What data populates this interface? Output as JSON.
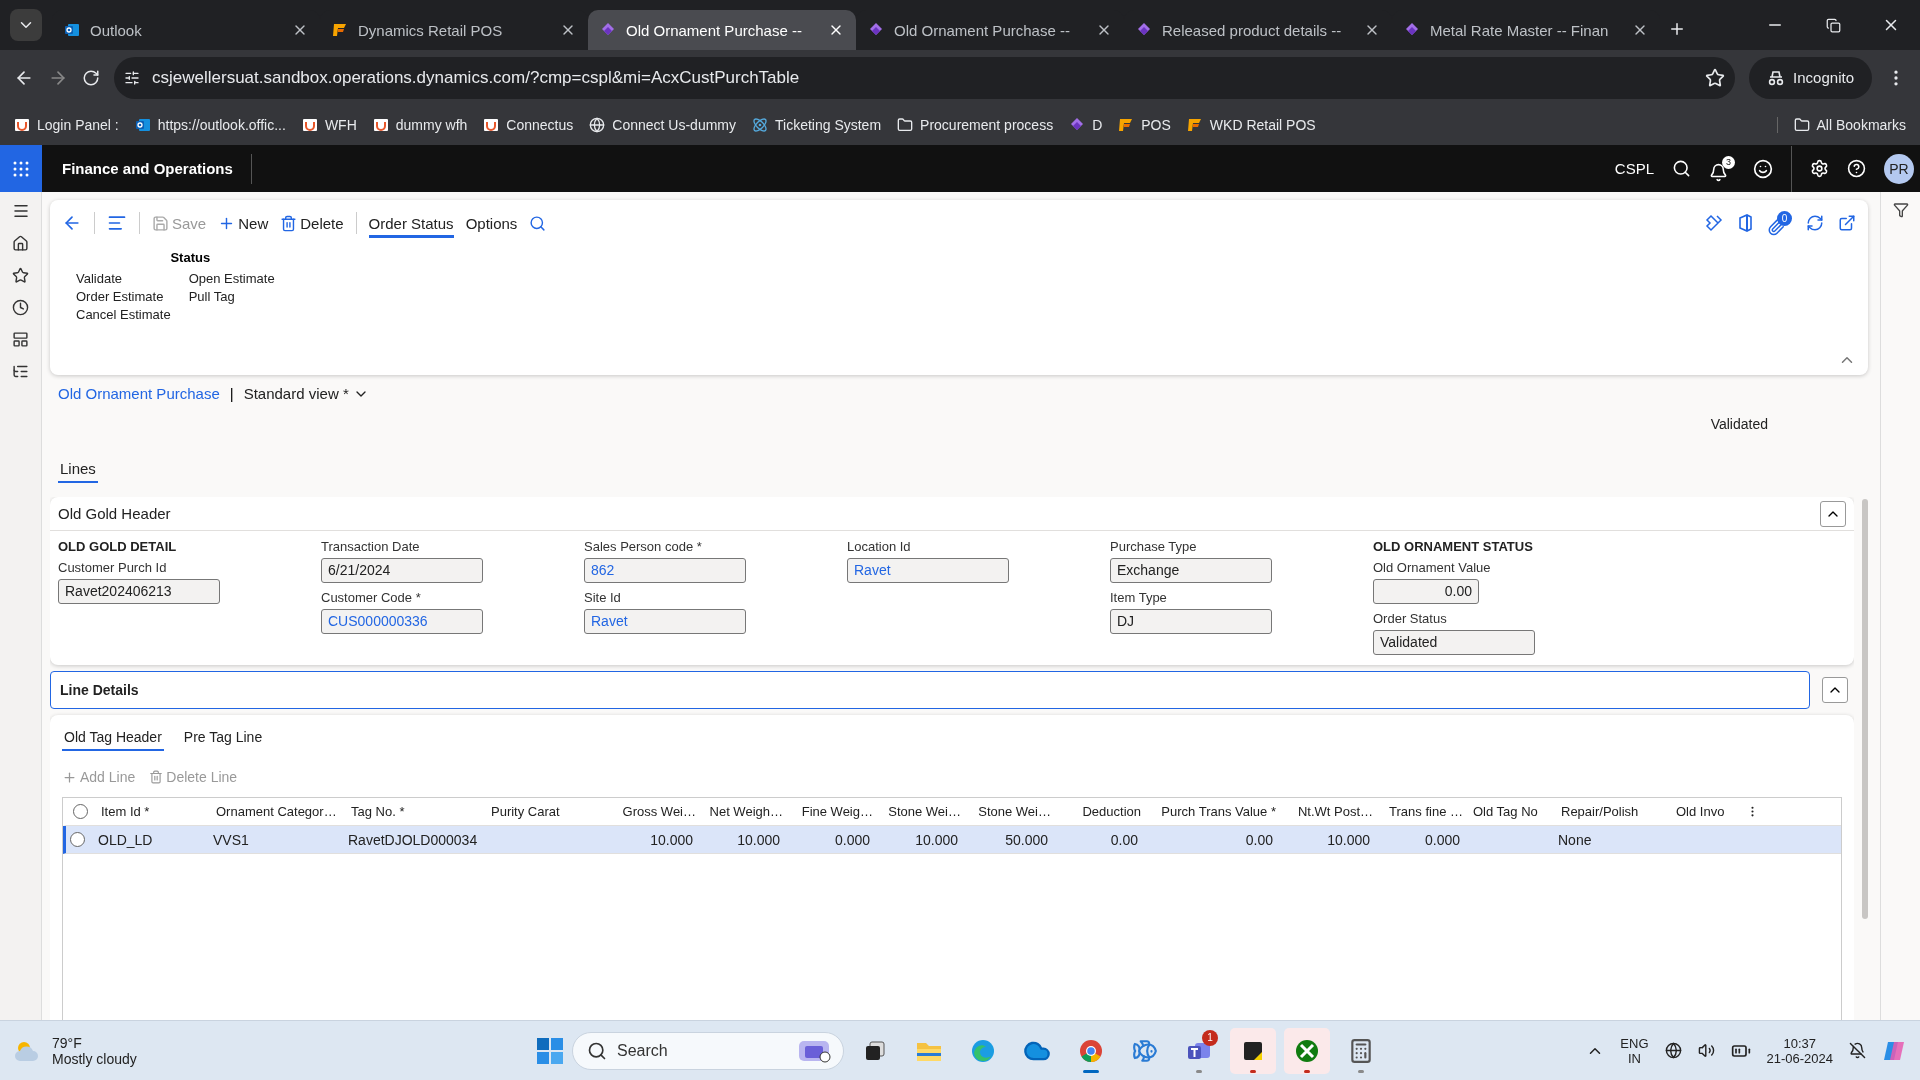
{
  "browser": {
    "tabs": [
      {
        "title": "Outlook",
        "selected": false
      },
      {
        "title": "Dynamics Retail POS",
        "selected": false
      },
      {
        "title": "Old Ornament Purchase --",
        "selected": true
      },
      {
        "title": "Old Ornament Purchase --",
        "selected": false
      },
      {
        "title": "Released product details --",
        "selected": false
      },
      {
        "title": "Metal Rate Master -- Finan",
        "selected": false
      }
    ],
    "address": "csjewellersuat.sandbox.operations.dynamics.com/?cmp=cspl&mi=AcxCustPurchTable",
    "profile": "Incognito",
    "bookmarks": [
      "Login Panel :",
      "https://outlook.offic...",
      "WFH",
      "dummy wfh",
      "Connectus",
      "Connect Us-dummy",
      "Ticketing System",
      "Procurement process",
      "D",
      "POS",
      "WKD Retail POS"
    ],
    "all_bookmarks": "All Bookmarks"
  },
  "app": {
    "title": "Finance and Operations",
    "company": "CSPL",
    "notifications": "3",
    "avatar": "PR"
  },
  "action_pane": {
    "buttons": [
      {
        "label": "Save",
        "kind": "save",
        "disabled": true
      },
      {
        "label": "New",
        "kind": "new",
        "disabled": false
      },
      {
        "label": "Delete",
        "kind": "delete",
        "disabled": false
      }
    ],
    "tabs": [
      {
        "label": "Order Status",
        "selected": true
      },
      {
        "label": "Options",
        "selected": false
      }
    ],
    "attachments": "0",
    "group": {
      "title": "Status",
      "columns": [
        [
          "Validate",
          "Order Estimate",
          "Cancel Estimate"
        ],
        [
          "Open Estimate",
          "Pull Tag"
        ]
      ]
    }
  },
  "breadcrumb": {
    "form": "Old Ornament Purchase",
    "separator": "|",
    "view": "Standard view *"
  },
  "record_status": "Validated",
  "page_tabs": [
    {
      "label": "Lines",
      "selected": true
    }
  ],
  "header": {
    "title": "Old Gold Header",
    "columns": [
      [
        {
          "kind": "heading",
          "label": "OLD GOLD DETAIL"
        },
        {
          "kind": "field",
          "label": "Customer Purch Id",
          "value": "Ravet202406213",
          "link": false,
          "numeric": false
        }
      ],
      [
        {
          "kind": "field",
          "label": "Transaction Date",
          "value": "6/21/2024",
          "link": false,
          "numeric": false
        },
        {
          "kind": "field",
          "label": "Customer Code *",
          "value": "CUS000000336",
          "link": true,
          "numeric": false
        }
      ],
      [
        {
          "kind": "field",
          "label": "Sales Person code *",
          "value": "862",
          "link": true,
          "numeric": false
        },
        {
          "kind": "field",
          "label": "Site Id",
          "value": "Ravet",
          "link": true,
          "numeric": false
        }
      ],
      [
        {
          "kind": "field",
          "label": "Location Id",
          "value": "Ravet",
          "link": true,
          "numeric": false
        }
      ],
      [
        {
          "kind": "field",
          "label": "Purchase Type",
          "value": "Exchange",
          "link": false,
          "numeric": false
        },
        {
          "kind": "field",
          "label": "Item Type",
          "value": "DJ",
          "link": false,
          "numeric": false
        }
      ],
      [
        {
          "kind": "heading",
          "label": "OLD ORNAMENT STATUS"
        },
        {
          "kind": "field",
          "label": "Old Ornament Value",
          "value": "0.00",
          "link": false,
          "numeric": true
        },
        {
          "kind": "field",
          "label": "Order Status",
          "value": "Validated",
          "link": false,
          "numeric": false
        }
      ]
    ]
  },
  "line_details": {
    "title": "Line Details",
    "tabs": [
      {
        "label": "Old Tag Header",
        "selected": true
      },
      {
        "label": "Pre Tag Line",
        "selected": false
      }
    ],
    "toolbar": [
      {
        "label": "Add Line",
        "kind": "add",
        "disabled": true
      },
      {
        "label": "Delete Line",
        "kind": "delete",
        "disabled": true
      }
    ],
    "all_selected": false,
    "columns": [
      {
        "label": "Item Id *",
        "numeric": false
      },
      {
        "label": "Ornament Categor…",
        "numeric": false
      },
      {
        "label": "Tag No. *",
        "numeric": false
      },
      {
        "label": "Purity Carat",
        "numeric": false
      },
      {
        "label": "Gross Wei…",
        "numeric": true
      },
      {
        "label": "Net Weigh…",
        "numeric": true
      },
      {
        "label": "Fine Weig…",
        "numeric": true
      },
      {
        "label": "Stone Wei…",
        "numeric": true
      },
      {
        "label": "Stone Wei…",
        "numeric": true
      },
      {
        "label": "Deduction",
        "numeric": true
      },
      {
        "label": "Purch Trans Value *",
        "numeric": true
      },
      {
        "label": "Nt.Wt Post…",
        "numeric": true
      },
      {
        "label": "Trans fine …",
        "numeric": true
      },
      {
        "label": "Old Tag No",
        "numeric": false
      },
      {
        "label": "Repair/Polish",
        "numeric": false
      },
      {
        "label": "Old Invo",
        "numeric": false
      }
    ],
    "rows": [
      {
        "selected": true,
        "checked": false,
        "cells": [
          "OLD_LD",
          "VVS1",
          "RavetDJOLD000034",
          null,
          "10.000",
          "10.000",
          "0.000",
          "10.000",
          "50.000",
          "0.00",
          "0.00",
          "10.000",
          "0.000",
          null,
          "None",
          null
        ]
      }
    ]
  },
  "taskbar": {
    "temperature": "79°F",
    "weather": "Mostly cloudy",
    "search": "Search",
    "apps": [
      {
        "kind": "taskview",
        "running": false,
        "focused": false,
        "alert": false
      },
      {
        "kind": "explorer",
        "running": false,
        "focused": false,
        "alert": false
      },
      {
        "kind": "edge",
        "running": false,
        "focused": false,
        "alert": false
      },
      {
        "kind": "onedrive",
        "running": false,
        "focused": false,
        "alert": false
      },
      {
        "kind": "chrome",
        "running": true,
        "focused": true,
        "alert": false
      },
      {
        "kind": "dolphin",
        "running": false,
        "focused": false,
        "alert": false
      },
      {
        "kind": "teams",
        "running": true,
        "focused": false,
        "alert": false,
        "badge": "1"
      },
      {
        "kind": "sticky",
        "running": true,
        "focused": false,
        "alert": true
      },
      {
        "kind": "xbox",
        "running": true,
        "focused": false,
        "alert": true
      },
      {
        "kind": "calculator",
        "running": true,
        "focused": false,
        "alert": false
      }
    ],
    "language": "ENG",
    "region": "IN",
    "time": "10:37",
    "date": "21-06-2024"
  }
}
